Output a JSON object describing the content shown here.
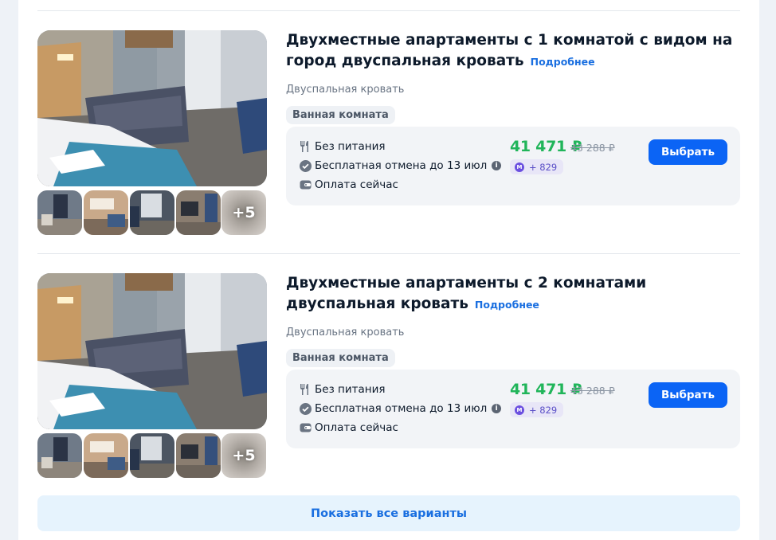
{
  "rooms": [
    {
      "title": "Двухместные апартаменты с 1 комнатой с видом на город двуспальная кровать",
      "more_link": "Подробнее",
      "bed": "Двуспальная кровать",
      "amenity": "Ванная комната",
      "conditions": [
        "Без питания",
        "Бесплатная отмена до 13 июл",
        "Оплата сейчас"
      ],
      "price": "41 471 ₽",
      "old_price": "43 288 ₽",
      "bonus": "+ 829",
      "button": "Выбрать",
      "more_photos": "+5"
    },
    {
      "title": "Двухместные апартаменты с 2 комнатами двуспальная кровать",
      "more_link": "Подробнее",
      "bed": "Двуспальная кровать",
      "amenity": "Ванная комната",
      "conditions": [
        "Без питания",
        "Бесплатная отмена до 13 июл",
        "Оплата сейчас"
      ],
      "price": "41 471 ₽",
      "old_price": "43 288 ₽",
      "bonus": "+ 829",
      "button": "Выбрать",
      "more_photos": "+5"
    }
  ],
  "show_all": "Показать все варианты",
  "colors": {
    "price": "#21b55a",
    "button": "#0b64f5",
    "link": "#1a6fe0",
    "bonus": "#5a4fc7"
  },
  "icons": [
    "fork-knife-icon",
    "check-circle-icon",
    "info-icon",
    "wallet-icon",
    "m-coin-icon"
  ]
}
